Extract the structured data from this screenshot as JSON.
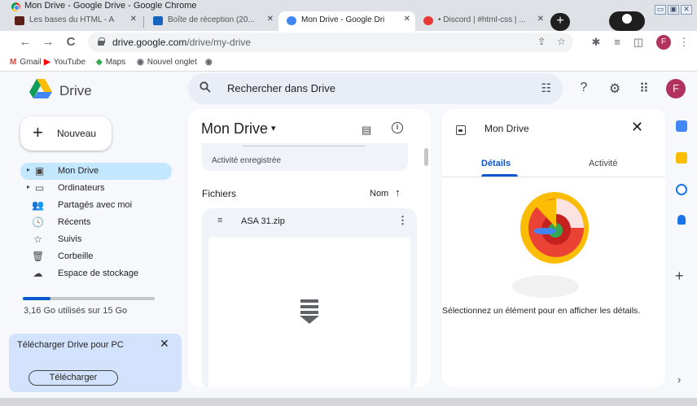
{
  "window": {
    "title": "Mon Drive - Google Drive - Google Chrome",
    "buttons": [
      "▭",
      "▣",
      "✕"
    ]
  },
  "tabs": [
    {
      "label": "Les bases du HTML - A",
      "favicon_color": "#5e1f1a",
      "active": false
    },
    {
      "label": "Boîte de réception (20...",
      "favicon_color": "#1565c0",
      "active": false
    },
    {
      "label": "Mon Drive - Google Dri",
      "favicon_color": "#4285f4",
      "active": true
    },
    {
      "label": "• Discord | #html-css | ...",
      "favicon_color": "#e53935",
      "active": false
    }
  ],
  "toolbar": {
    "url_host": "drive.google.com",
    "url_path": "/drive/my-drive",
    "profile_initial": "F"
  },
  "bookmarks": [
    {
      "label": "Gmail",
      "icon": "M",
      "color": "#ea4335"
    },
    {
      "label": "YouTube",
      "icon": "▶",
      "color": "#ff0000"
    },
    {
      "label": "Maps",
      "icon": "◆",
      "color": "#34a853"
    },
    {
      "label": "Nouvel onglet",
      "icon": "◉",
      "color": "#5f6368"
    },
    {
      "label": "",
      "icon": "◉",
      "color": "#5f6368"
    }
  ],
  "drive": {
    "brand": "Drive",
    "search_placeholder": "Rechercher dans Drive",
    "avatar_initial": "F"
  },
  "sidebar": {
    "new_label": "Nouveau",
    "items": [
      {
        "label": "Mon Drive",
        "icon": "drive-icon",
        "glyph": "▣",
        "caret": true,
        "active": true
      },
      {
        "label": "Ordinateurs",
        "icon": "computer-icon",
        "glyph": "▭",
        "caret": true,
        "active": false
      },
      {
        "label": "Partagés avec moi",
        "icon": "people-icon",
        "glyph": "👥",
        "caret": false,
        "active": false
      },
      {
        "label": "Récents",
        "icon": "clock-icon",
        "glyph": "🕓",
        "caret": false,
        "active": false
      },
      {
        "label": "Suivis",
        "icon": "star-icon",
        "glyph": "☆",
        "caret": false,
        "active": false
      },
      {
        "label": "Corbeille",
        "icon": "trash-icon",
        "glyph": "🗑",
        "caret": false,
        "active": false
      },
      {
        "label": "Espace de stockage",
        "icon": "cloud-icon",
        "glyph": "☁",
        "caret": false,
        "active": false
      }
    ],
    "storage_used_fraction": 0.21,
    "storage_text": "3,16 Go utilisés sur 15 Go",
    "promo_text": "Télécharger Drive pour PC",
    "promo_button": "Télécharger"
  },
  "main": {
    "title": "Mon Drive",
    "activity_text": "Activité enregistrée",
    "files_label": "Fichiers",
    "sort_label": "Nom",
    "file_name": "ASA 31.zip"
  },
  "details": {
    "title": "Mon Drive",
    "tab_details": "Détails",
    "tab_activity": "Activité",
    "message": "Sélectionnez un élément pour en afficher les détails."
  },
  "rail": [
    {
      "name": "calendar-icon",
      "color": "#4285f4"
    },
    {
      "name": "keep-icon",
      "color": "#fbbc04"
    },
    {
      "name": "tasks-icon",
      "color": "#1a73e8"
    },
    {
      "name": "contacts-icon",
      "color": "#1a73e8"
    }
  ],
  "colors": {
    "accent": "#0b57d0",
    "selected_nav": "#c2e7ff",
    "promo_bg": "#d3e3fd",
    "background": "#f6f8fc"
  }
}
